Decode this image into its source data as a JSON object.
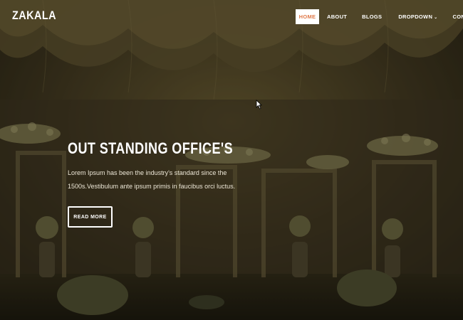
{
  "brand": {
    "logo_text": "ZAKALA"
  },
  "nav": {
    "items": [
      {
        "label": "HOME",
        "active": true
      },
      {
        "label": "ABOUT"
      },
      {
        "label": "BLOGS"
      },
      {
        "label": "DROPDOWN"
      },
      {
        "label": "CONTACT"
      }
    ],
    "dropdown_caret_icon": "chevron-down-icon"
  },
  "hero": {
    "title": "OUT STANDING OFFICE'S",
    "description": "Lorem Ipsum has been the industry's standard since the 1500s.Vestibulum ante ipsum primis in faucibus orci luctus.",
    "button_label": "READ MORE"
  },
  "colors": {
    "active_nav_text": "#e07a4a",
    "overlay": "#2a2416",
    "text": "#ffffff"
  }
}
